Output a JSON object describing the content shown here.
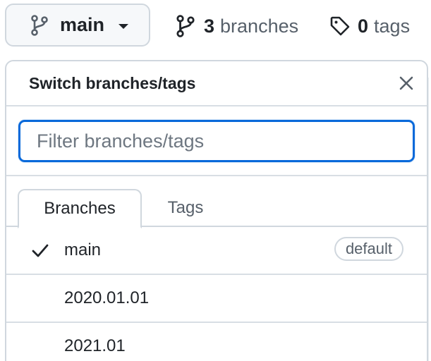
{
  "topbar": {
    "branch_button": {
      "label": "main",
      "icon": "git-branch-icon"
    },
    "branches_stat": {
      "count": "3",
      "label": "branches",
      "icon": "git-branch-icon"
    },
    "tags_stat": {
      "count": "0",
      "label": "tags",
      "icon": "tag-icon"
    }
  },
  "dropdown": {
    "title": "Switch branches/tags",
    "close_icon": "close-icon",
    "filter": {
      "placeholder": "Filter branches/tags",
      "value": ""
    },
    "tabs": [
      {
        "label": "Branches",
        "active": true
      },
      {
        "label": "Tags",
        "active": false
      }
    ],
    "items": [
      {
        "name": "main",
        "selected": true,
        "badge": "default"
      },
      {
        "name": "2020.01.01",
        "selected": false,
        "badge": ""
      },
      {
        "name": "2021.01",
        "selected": false,
        "badge": ""
      }
    ]
  },
  "colors": {
    "accent": "#0969da",
    "border": "#d0d7de",
    "text": "#1f2328",
    "muted": "#57606a",
    "button_bg": "#f6f8fa"
  }
}
